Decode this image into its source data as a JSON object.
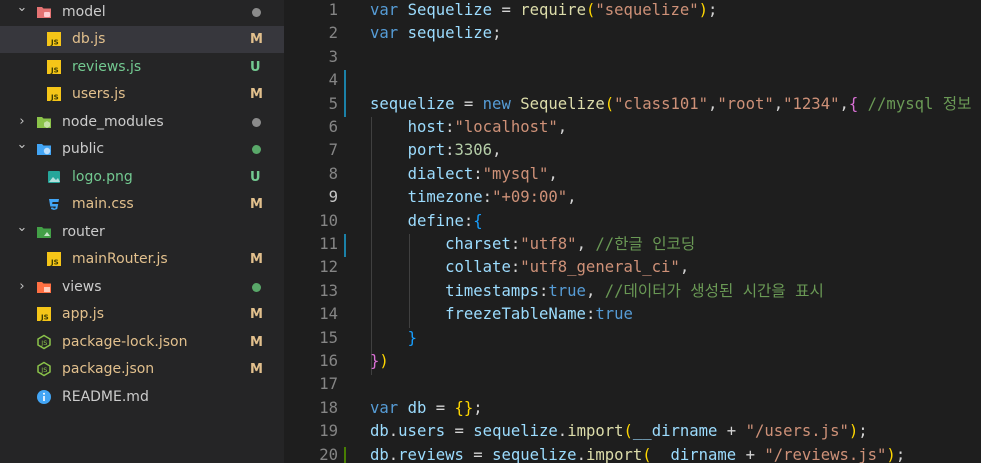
{
  "colors": {
    "modified": "#e2c08d",
    "untracked": "#73c991",
    "ignored_dot": "#8b8b8b",
    "added_dot": "#59a869"
  },
  "explorer": {
    "items": [
      {
        "name": "model",
        "icon": "folder-model-icon",
        "kind": "folder",
        "open": true,
        "depth": 0,
        "status": "dot-gray"
      },
      {
        "name": "db.js",
        "icon": "js-file-icon",
        "kind": "file",
        "depth": 1,
        "status": "M",
        "selected": true
      },
      {
        "name": "reviews.js",
        "icon": "js-file-icon",
        "kind": "file",
        "depth": 1,
        "status": "U"
      },
      {
        "name": "users.js",
        "icon": "js-file-icon",
        "kind": "file",
        "depth": 1,
        "status": "M"
      },
      {
        "name": "node_modules",
        "icon": "folder-node-icon",
        "kind": "folder",
        "open": false,
        "depth": 0,
        "status": "dot-gray"
      },
      {
        "name": "public",
        "icon": "folder-public-icon",
        "kind": "folder",
        "open": true,
        "depth": 0,
        "status": "dot-green"
      },
      {
        "name": "logo.png",
        "icon": "image-file-icon",
        "kind": "file",
        "depth": 1,
        "status": "U"
      },
      {
        "name": "main.css",
        "icon": "css-file-icon",
        "kind": "file",
        "depth": 1,
        "status": "M"
      },
      {
        "name": "router",
        "icon": "folder-router-icon",
        "kind": "folder",
        "open": true,
        "depth": 0,
        "status": "none"
      },
      {
        "name": "mainRouter.js",
        "icon": "js-file-icon",
        "kind": "file",
        "depth": 1,
        "status": "M"
      },
      {
        "name": "views",
        "icon": "folder-views-icon",
        "kind": "folder",
        "open": false,
        "depth": 0,
        "status": "dot-green"
      },
      {
        "name": "app.js",
        "icon": "js-file-icon",
        "kind": "file",
        "depth": 0,
        "status": "M"
      },
      {
        "name": "package-lock.json",
        "icon": "nodejs-file-icon",
        "kind": "file",
        "depth": 0,
        "status": "M"
      },
      {
        "name": "package.json",
        "icon": "nodejs-file-icon",
        "kind": "file",
        "depth": 0,
        "status": "M"
      },
      {
        "name": "README.md",
        "icon": "info-file-icon",
        "kind": "file",
        "depth": 0,
        "status": "none"
      }
    ]
  },
  "editor": {
    "active_line": 9,
    "lines": [
      {
        "n": "1",
        "tokens": [
          [
            "k",
            "var "
          ],
          [
            "v",
            "Sequelize"
          ],
          [
            "t",
            " = "
          ],
          [
            "f",
            "require"
          ],
          [
            "y",
            "("
          ],
          [
            "s",
            "\"sequelize\""
          ],
          [
            "y",
            ")"
          ],
          [
            "t",
            ";"
          ]
        ]
      },
      {
        "n": "2",
        "tokens": [
          [
            "k",
            "var "
          ],
          [
            "v",
            "sequelize"
          ],
          [
            "t",
            ";"
          ]
        ]
      },
      {
        "n": "3",
        "tokens": []
      },
      {
        "n": "4",
        "tokens": []
      },
      {
        "n": "5",
        "tokens": [
          [
            "v",
            "sequelize"
          ],
          [
            "t",
            " = "
          ],
          [
            "k",
            "new "
          ],
          [
            "f",
            "Sequelize"
          ],
          [
            "y",
            "("
          ],
          [
            "s",
            "\"class101\""
          ],
          [
            "t",
            ","
          ],
          [
            "s",
            "\"root\""
          ],
          [
            "t",
            ","
          ],
          [
            "s",
            "\"1234\""
          ],
          [
            "t",
            ","
          ],
          [
            "p",
            "{"
          ],
          [
            "t",
            " "
          ],
          [
            "c",
            "//mysql 정보"
          ]
        ]
      },
      {
        "n": "6",
        "tokens": [
          [
            "t",
            "    "
          ],
          [
            "v",
            "host"
          ],
          [
            "t",
            ":"
          ],
          [
            "s",
            "\"localhost\""
          ],
          [
            "t",
            ","
          ]
        ]
      },
      {
        "n": "7",
        "tokens": [
          [
            "t",
            "    "
          ],
          [
            "v",
            "port"
          ],
          [
            "t",
            ":"
          ],
          [
            "n",
            "3306"
          ],
          [
            "t",
            ","
          ]
        ]
      },
      {
        "n": "8",
        "tokens": [
          [
            "t",
            "    "
          ],
          [
            "v",
            "dialect"
          ],
          [
            "t",
            ":"
          ],
          [
            "s",
            "\"mysql\""
          ],
          [
            "t",
            ","
          ]
        ]
      },
      {
        "n": "9",
        "tokens": [
          [
            "t",
            "    "
          ],
          [
            "v",
            "timezone"
          ],
          [
            "t",
            ":"
          ],
          [
            "s",
            "\"+09:00\""
          ],
          [
            "t",
            ","
          ]
        ]
      },
      {
        "n": "10",
        "tokens": [
          [
            "t",
            "    "
          ],
          [
            "v",
            "define"
          ],
          [
            "t",
            ":"
          ],
          [
            "b",
            "{"
          ]
        ]
      },
      {
        "n": "11",
        "tokens": [
          [
            "t",
            "        "
          ],
          [
            "v",
            "charset"
          ],
          [
            "t",
            ":"
          ],
          [
            "s",
            "\"utf8\""
          ],
          [
            "t",
            ", "
          ],
          [
            "c",
            "//한글 인코딩"
          ]
        ]
      },
      {
        "n": "12",
        "tokens": [
          [
            "t",
            "        "
          ],
          [
            "v",
            "collate"
          ],
          [
            "t",
            ":"
          ],
          [
            "s",
            "\"utf8_general_ci\""
          ],
          [
            "t",
            ","
          ]
        ]
      },
      {
        "n": "13",
        "tokens": [
          [
            "t",
            "        "
          ],
          [
            "v",
            "timestamps"
          ],
          [
            "t",
            ":"
          ],
          [
            "k",
            "true"
          ],
          [
            "t",
            ", "
          ],
          [
            "c",
            "//데이터가 생성된 시간을 표시"
          ]
        ]
      },
      {
        "n": "14",
        "tokens": [
          [
            "t",
            "        "
          ],
          [
            "v",
            "freezeTableName"
          ],
          [
            "t",
            ":"
          ],
          [
            "k",
            "true"
          ]
        ]
      },
      {
        "n": "15",
        "tokens": [
          [
            "t",
            "    "
          ],
          [
            "b",
            "}"
          ]
        ]
      },
      {
        "n": "16",
        "tokens": [
          [
            "p",
            "}"
          ],
          [
            "y",
            ")"
          ]
        ]
      },
      {
        "n": "17",
        "tokens": []
      },
      {
        "n": "18",
        "tokens": [
          [
            "k",
            "var "
          ],
          [
            "v",
            "db"
          ],
          [
            "t",
            " = "
          ],
          [
            "y",
            "{}"
          ],
          [
            "t",
            ";"
          ]
        ]
      },
      {
        "n": "19",
        "tokens": [
          [
            "v",
            "db"
          ],
          [
            "t",
            "."
          ],
          [
            "v",
            "users"
          ],
          [
            "t",
            " = "
          ],
          [
            "v",
            "sequelize"
          ],
          [
            "t",
            "."
          ],
          [
            "f",
            "import"
          ],
          [
            "y",
            "("
          ],
          [
            "v",
            "__dirname"
          ],
          [
            "t",
            " + "
          ],
          [
            "s",
            "\"/users.js\""
          ],
          [
            "y",
            ")"
          ],
          [
            "t",
            ";"
          ]
        ]
      },
      {
        "n": "20",
        "tokens": [
          [
            "v",
            "db"
          ],
          [
            "t",
            "."
          ],
          [
            "v",
            "reviews"
          ],
          [
            "t",
            " = "
          ],
          [
            "v",
            "sequelize"
          ],
          [
            "t",
            "."
          ],
          [
            "f",
            "import"
          ],
          [
            "y",
            "("
          ],
          [
            "v",
            "__dirname"
          ],
          [
            "t",
            " + "
          ],
          [
            "s",
            "\"/reviews.js\""
          ],
          [
            "y",
            ")"
          ],
          [
            "t",
            ";"
          ]
        ]
      }
    ]
  }
}
